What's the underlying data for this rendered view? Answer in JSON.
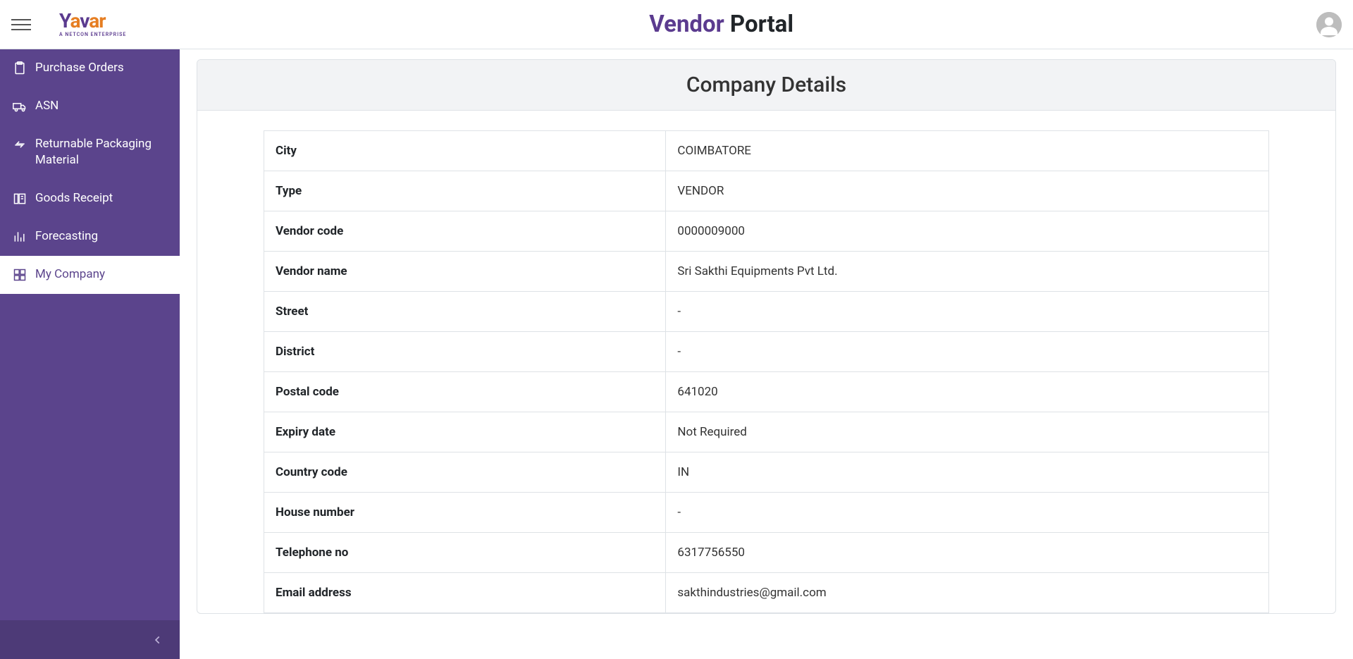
{
  "header": {
    "logo_main": "Yavar",
    "logo_sub": "A NETCON ENTERPRISE",
    "title_vendor": "Vendor",
    "title_portal": " Portal"
  },
  "sidebar": {
    "items": [
      {
        "label": "Purchase Orders",
        "icon": "clipboard"
      },
      {
        "label": "ASN",
        "icon": "truck"
      },
      {
        "label": "Returnable Packaging Material",
        "icon": "return"
      },
      {
        "label": "Goods Receipt",
        "icon": "receipt"
      },
      {
        "label": "Forecasting",
        "icon": "chart"
      },
      {
        "label": "My Company",
        "icon": "company"
      }
    ],
    "active_index": 5
  },
  "main": {
    "card_title": "Company Details",
    "rows": [
      {
        "label": "City",
        "value": "COIMBATORE"
      },
      {
        "label": "Type",
        "value": "VENDOR"
      },
      {
        "label": "Vendor code",
        "value": "0000009000"
      },
      {
        "label": "Vendor name",
        "value": "Sri Sakthi Equipments Pvt Ltd."
      },
      {
        "label": "Street",
        "value": "-"
      },
      {
        "label": "District",
        "value": "-"
      },
      {
        "label": "Postal code",
        "value": "641020"
      },
      {
        "label": "Expiry date",
        "value": "Not Required"
      },
      {
        "label": "Country code",
        "value": "IN"
      },
      {
        "label": "House number",
        "value": "-"
      },
      {
        "label": "Telephone no",
        "value": "6317756550"
      },
      {
        "label": "Email address",
        "value": "sakthindustries@gmail.com"
      }
    ]
  }
}
